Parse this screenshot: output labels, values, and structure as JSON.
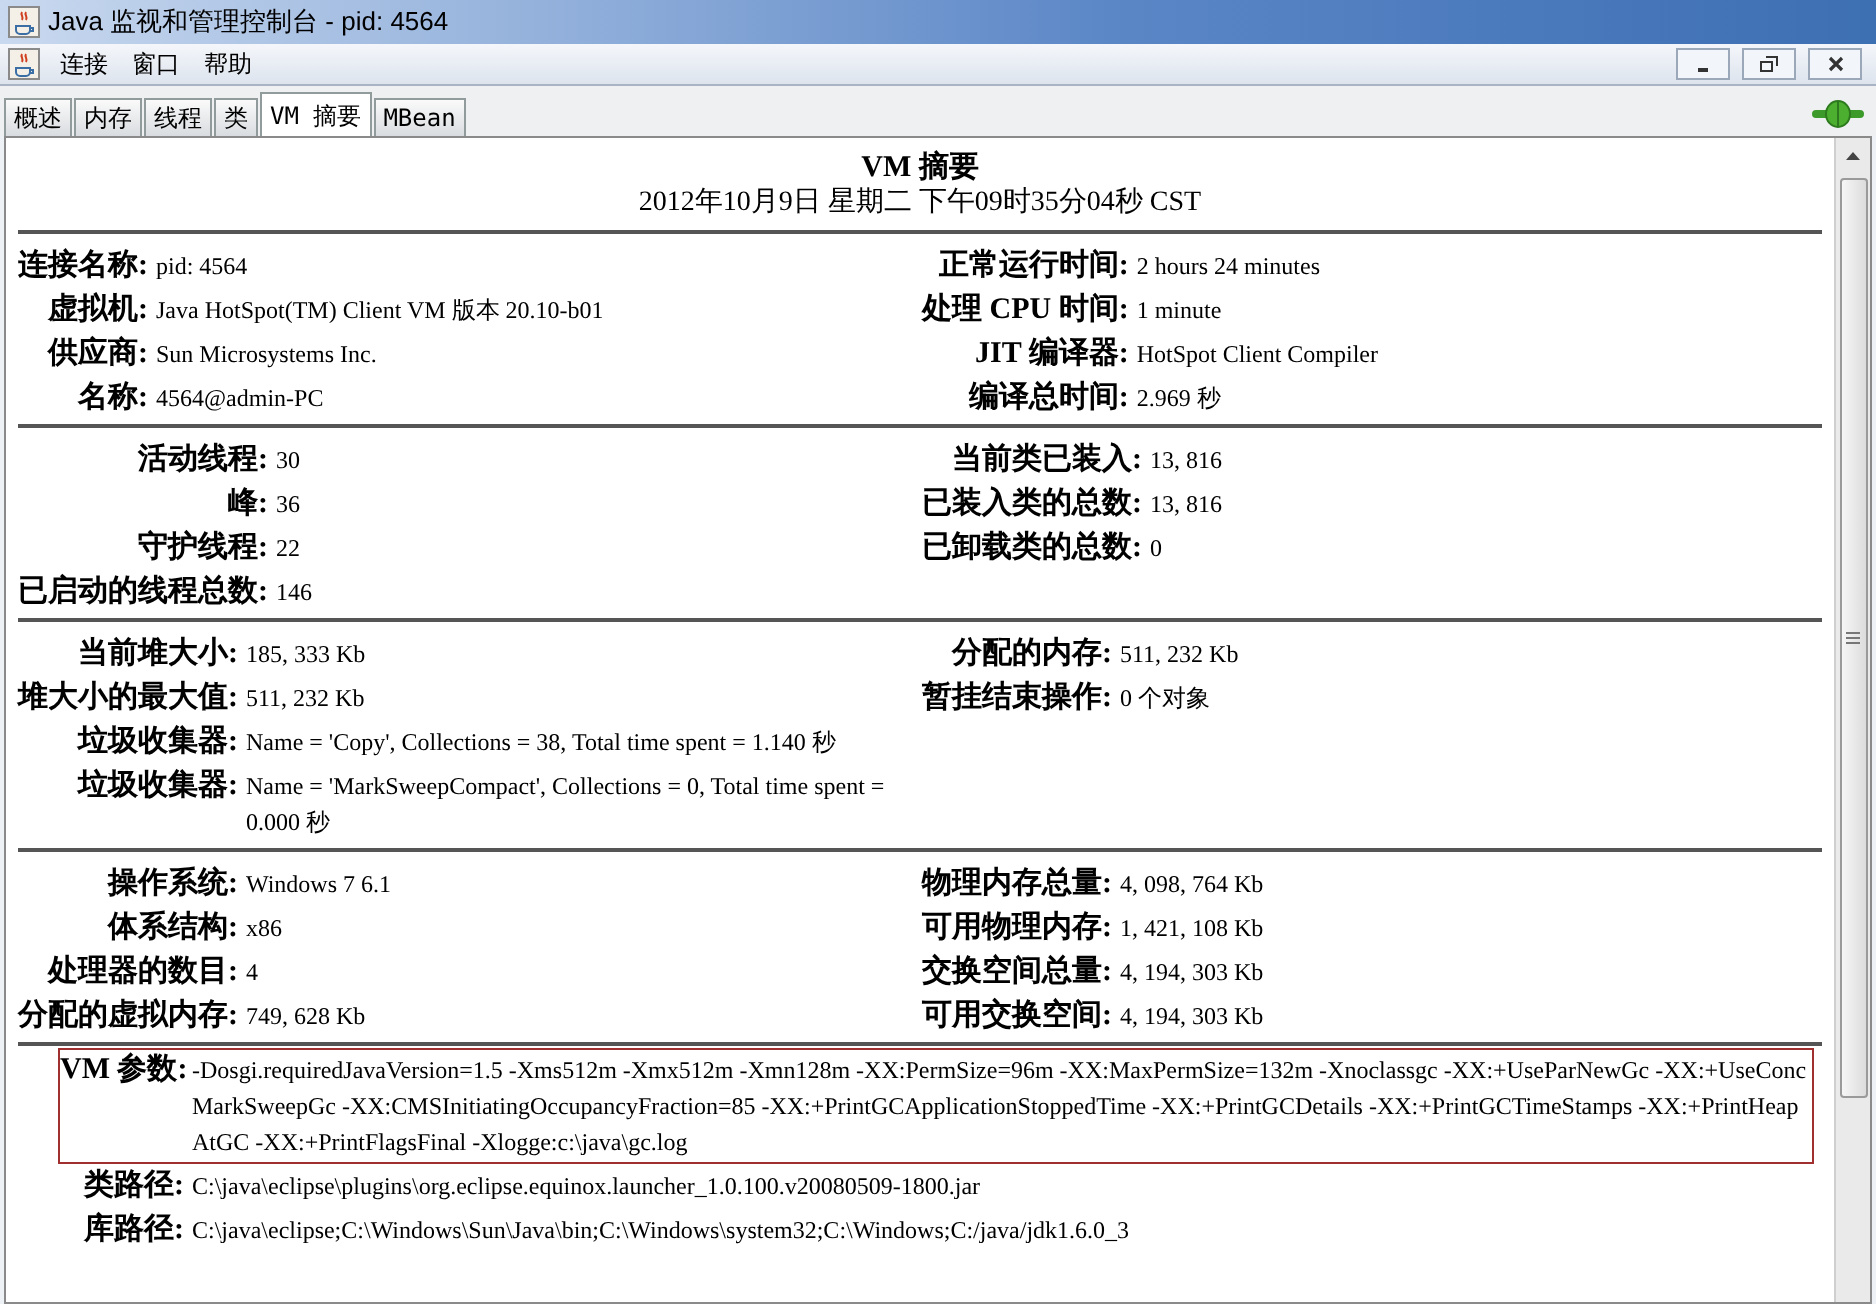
{
  "window": {
    "title": "Java 监视和管理控制台 - pid: 4564"
  },
  "menu": [
    "连接",
    "窗口",
    "帮助"
  ],
  "tabs": [
    {
      "label": "概述",
      "selected": false
    },
    {
      "label": "内存",
      "selected": false
    },
    {
      "label": "线程",
      "selected": false
    },
    {
      "label": "类",
      "selected": false
    },
    {
      "label": "VM 摘要",
      "selected": true
    },
    {
      "label": "MBean",
      "selected": false
    }
  ],
  "summary": {
    "title": "VM 摘要",
    "timestamp": "2012年10月9日 星期二 下午09时35分04秒 CST",
    "sections": [
      {
        "left": [
          {
            "label": "连接名称:",
            "value": "pid: 4564"
          },
          {
            "label": "虚拟机:",
            "value": "Java HotSpot(TM) Client VM 版本 20.10-b01"
          },
          {
            "label": "供应商:",
            "value": "Sun Microsystems Inc."
          },
          {
            "label": "名称:",
            "value": "4564@admin-PC"
          }
        ],
        "right": [
          {
            "label": "正常运行时间:",
            "value": "2 hours 24 minutes"
          },
          {
            "label": "处理 CPU 时间:",
            "value": "1 minute"
          },
          {
            "label": "JIT 编译器:",
            "value": "HotSpot Client Compiler"
          },
          {
            "label": "编译总时间:",
            "value": "2.969 秒"
          }
        ]
      },
      {
        "left": [
          {
            "label": "活动线程:",
            "value": "30"
          },
          {
            "label": "峰:",
            "value": "36"
          },
          {
            "label": "守护线程:",
            "value": "22"
          },
          {
            "label": "已启动的线程总数:",
            "value": "146"
          }
        ],
        "right": [
          {
            "label": "当前类已装入:",
            "value": "13, 816"
          },
          {
            "label": "已装入类的总数:",
            "value": "13, 816"
          },
          {
            "label": "已卸载类的总数:",
            "value": "0"
          }
        ]
      },
      {
        "left": [
          {
            "label": "当前堆大小:",
            "value": "185, 333 Kb"
          },
          {
            "label": "堆大小的最大值:",
            "value": "511, 232 Kb"
          },
          {
            "label": "垃圾收集器:",
            "value": "Name = 'Copy', Collections = 38, Total time spent = 1.140 秒"
          },
          {
            "label": "垃圾收集器:",
            "value": "Name = 'MarkSweepCompact', Collections = 0, Total time spent = 0.000 秒"
          }
        ],
        "right": [
          {
            "label": "分配的内存:",
            "value": "511, 232 Kb"
          },
          {
            "label": "暂挂结束操作:",
            "value": "0 个对象"
          }
        ]
      },
      {
        "left": [
          {
            "label": "操作系统:",
            "value": "Windows 7 6.1"
          },
          {
            "label": "体系结构:",
            "value": "x86"
          },
          {
            "label": "处理器的数目:",
            "value": "4"
          },
          {
            "label": "分配的虚拟内存:",
            "value": "749, 628 Kb"
          }
        ],
        "right": [
          {
            "label": "物理内存总量:",
            "value": "4, 098, 764 Kb"
          },
          {
            "label": "可用物理内存:",
            "value": "1, 421, 108 Kb"
          },
          {
            "label": "交换空间总量:",
            "value": "4, 194, 303 Kb"
          },
          {
            "label": "可用交换空间:",
            "value": "4, 194, 303 Kb"
          }
        ]
      }
    ],
    "details": [
      {
        "label": "VM 参数:",
        "value": "-Dosgi.requiredJavaVersion=1.5 -Xms512m -Xmx512m -Xmn128m -XX:PermSize=96m -XX:MaxPermSize=132m -Xnoclassgc -XX:+UseParNewGc -XX:+UseConcMarkSweepGc -XX:CMSInitiatingOccupancyFraction=85 -XX:+PrintGCApplicationStoppedTime -XX:+PrintGCDetails -XX:+PrintGCTimeStamps -XX:+PrintHeapAtGC -XX:+PrintFlagsFinal -Xlogge:c:\\java\\gc.log",
        "highlighted": true
      },
      {
        "label": "类路径:",
        "value": "C:\\java\\eclipse\\plugins\\org.eclipse.equinox.launcher_1.0.100.v20080509-1800.jar",
        "highlighted": false
      },
      {
        "label": "库路径:",
        "value": "C:\\java\\eclipse;C:\\Windows\\Sun\\Java\\bin;C:\\Windows\\system32;C:\\Windows;C:/java/jdk1.6.0_3",
        "highlighted": false
      }
    ]
  }
}
